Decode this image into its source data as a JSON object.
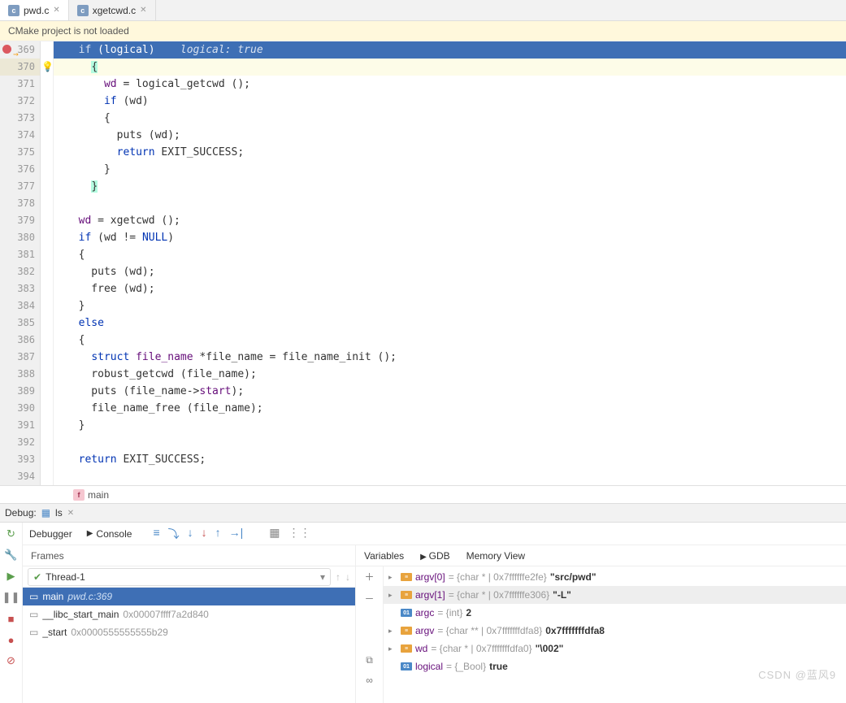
{
  "tabs": {
    "t1": "pwd.c",
    "t2": "xgetcwd.c"
  },
  "warning": "CMake project is not loaded",
  "gutter": [
    "369",
    "370",
    "371",
    "372",
    "373",
    "374",
    "375",
    "376",
    "377",
    "378",
    "379",
    "380",
    "381",
    "382",
    "383",
    "384",
    "385",
    "386",
    "387",
    "388",
    "389",
    "390",
    "391",
    "392",
    "393",
    "394"
  ],
  "code": {
    "l369_kw": "if",
    "l369_cond": " (logical)",
    "l369_hint": "    logical: true",
    "l370": "{",
    "l371_a": "    wd ",
    "l371_b": "= logical_getcwd ();",
    "l372_kw": "if",
    "l372_b": " (wd)",
    "l373": "      {",
    "l374": "        puts (wd);",
    "l375_kw": "return",
    "l375_b": " EXIT_SUCCESS;",
    "l376": "      }",
    "l377": "}",
    "l378": "",
    "l379_a": "wd ",
    "l379_b": "= xgetcwd ();",
    "l380_kw": "if",
    "l380_a": " (wd != ",
    "l380_null": "NULL",
    "l380_b": ")",
    "l381": "  {",
    "l382": "    puts (wd);",
    "l383": "    free (wd);",
    "l384": "  }",
    "l385_kw": "else",
    "l386": "  {",
    "l387_kw": "struct",
    "l387_t": " file_name ",
    "l387_b": "*file_name = file_name_init ();",
    "l388": "    robust_getcwd (file_name);",
    "l389_a": "    puts (file_name->",
    "l389_b": "start",
    "l389_c": ");",
    "l390": "    file_name_free (file_name);",
    "l391": "  }",
    "l392": "",
    "l393_kw": "return",
    "l393_b": " EXIT_SUCCESS;"
  },
  "breadcrumb": "main",
  "debug": {
    "title": "Debug:",
    "config": "ls",
    "tab_debugger": "Debugger",
    "tab_console": "Console",
    "frames_title": "Frames",
    "thread": "Thread-1",
    "frame_main": "main",
    "frame_main_loc": "pwd.c:369",
    "frame_libc": "__libc_start_main",
    "frame_libc_hex": "0x00007ffff7a2d840",
    "frame_start": "_start",
    "frame_start_hex": "0x0000555555555b29",
    "vars_tab_variables": "Variables",
    "vars_tab_gdb": "GDB",
    "vars_tab_mem": "Memory View",
    "v_argv0_name": "argv[0]",
    "v_argv0_type": " = {char * | 0x7ffffffe2fe} ",
    "v_argv0_val": "\"src/pwd\"",
    "v_argv1_name": "argv[1]",
    "v_argv1_type": " = {char * | 0x7ffffffe306} ",
    "v_argv1_val": "\"-L\"",
    "v_argc_name": "argc",
    "v_argc_type": " = {int} ",
    "v_argc_val": "2",
    "v_argv_name": "argv",
    "v_argv_type": " = {char ** | 0x7fffffffdfa8} ",
    "v_argv_val": "0x7fffffffdfa8",
    "v_wd_name": "wd",
    "v_wd_type": " = {char * | 0x7fffffffdfa0} ",
    "v_wd_val": "\"\\002\"",
    "v_logical_name": "logical",
    "v_logical_type": " = {_Bool} ",
    "v_logical_val": "true"
  },
  "watermark": "CSDN @蓝风9"
}
